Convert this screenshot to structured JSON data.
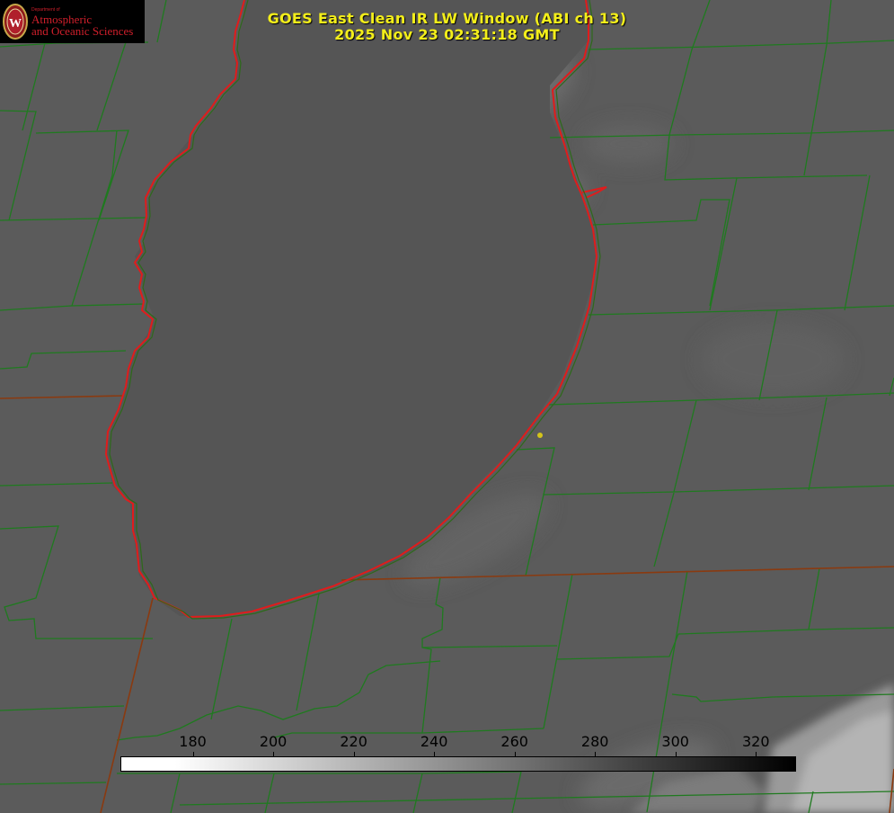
{
  "header": {
    "title_line1": "GOES East Clean IR LW Window (ABI ch 13)",
    "title_line2": "2025 Nov 23 02:31:18 GMT"
  },
  "logo": {
    "department": "Department of",
    "line1": "Atmospheric",
    "line2": "and Oceanic Sciences",
    "seal_letter": "W"
  },
  "colorbar": {
    "ticks": [
      "180",
      "200",
      "220",
      "240",
      "260",
      "280",
      "300",
      "320"
    ],
    "tick_values": [
      180,
      200,
      220,
      240,
      260,
      280,
      300,
      320
    ],
    "min": 162,
    "max": 330,
    "gradient": "white to black"
  },
  "colors": {
    "title": "#f3ee1a",
    "county_lines": "#1f7a1f",
    "lake_outline": "#e01c1c",
    "state_line": "#8a3a10",
    "background": "#595959",
    "lake": "#555555",
    "marker": "#d4c41a"
  }
}
